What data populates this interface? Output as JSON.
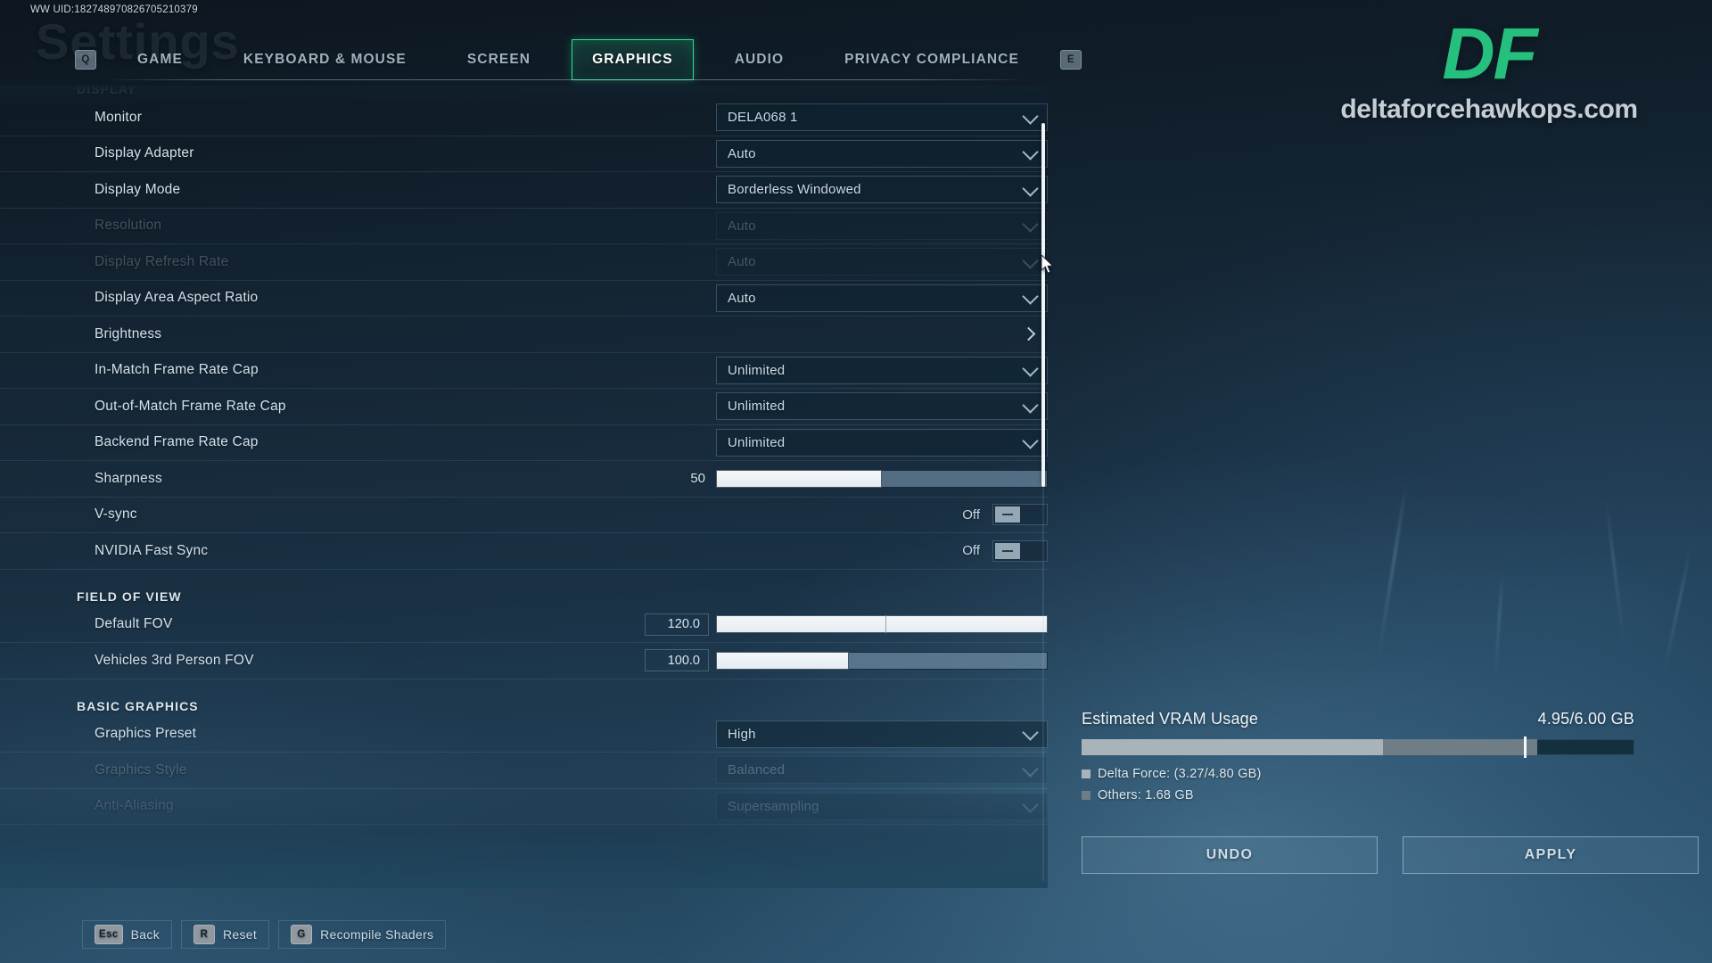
{
  "hud": {
    "uid": "WW UID:182748970826705210379",
    "ghost_title": "Settings",
    "accent_color": "#2fe08f"
  },
  "tabbar": {
    "left_key": "Q",
    "right_key": "E",
    "tabs": [
      {
        "label": "GAME",
        "active": false
      },
      {
        "label": "KEYBOARD & MOUSE",
        "active": false
      },
      {
        "label": "SCREEN",
        "active": false
      },
      {
        "label": "GRAPHICS",
        "active": true
      },
      {
        "label": "AUDIO",
        "active": false
      },
      {
        "label": "PRIVACY COMPLIANCE",
        "active": false
      }
    ]
  },
  "settings": {
    "sections": [
      {
        "title": "DISPLAY",
        "ghost": true,
        "rows": [
          {
            "type": "dropdown",
            "label": "Monitor",
            "value": "DELA068 1",
            "disabled": false
          },
          {
            "type": "dropdown",
            "label": "Display Adapter",
            "value": "Auto",
            "disabled": false
          },
          {
            "type": "dropdown",
            "label": "Display Mode",
            "value": "Borderless Windowed",
            "disabled": false
          },
          {
            "type": "dropdown",
            "label": "Resolution",
            "value": "Auto",
            "disabled": true
          },
          {
            "type": "dropdown",
            "label": "Display Refresh Rate",
            "value": "Auto",
            "disabled": true
          },
          {
            "type": "dropdown",
            "label": "Display Area Aspect Ratio",
            "value": "Auto",
            "disabled": false
          },
          {
            "type": "submenu",
            "label": "Brightness",
            "value": "",
            "disabled": false
          },
          {
            "type": "dropdown",
            "label": "In-Match Frame Rate Cap",
            "value": "Unlimited",
            "disabled": false
          },
          {
            "type": "dropdown",
            "label": "Out-of-Match Frame Rate Cap",
            "value": "Unlimited",
            "disabled": false
          },
          {
            "type": "dropdown",
            "label": "Backend Frame Rate Cap",
            "value": "Unlimited",
            "disabled": false
          },
          {
            "type": "slider",
            "label": "Sharpness",
            "value": "50",
            "percent": 50,
            "tick": null,
            "disabled": false
          },
          {
            "type": "toggle",
            "label": "V-sync",
            "value": "Off",
            "disabled": false
          },
          {
            "type": "toggle",
            "label": "NVIDIA Fast Sync",
            "value": "Off",
            "disabled": false
          }
        ]
      },
      {
        "title": "FIELD OF VIEW",
        "ghost": false,
        "rows": [
          {
            "type": "numslider",
            "label": "Default FOV",
            "value": "120.0",
            "percent": 100,
            "tick": 51,
            "disabled": false
          },
          {
            "type": "numslider",
            "label": "Vehicles 3rd Person FOV",
            "value": "100.0",
            "percent": 40,
            "tick": null,
            "disabled": false
          }
        ]
      },
      {
        "title": "BASIC GRAPHICS",
        "ghost": false,
        "rows": [
          {
            "type": "dropdown",
            "label": "Graphics Preset",
            "value": "High",
            "disabled": false
          },
          {
            "type": "dropdown",
            "label": "Graphics Style",
            "value": "Balanced",
            "disabled": true
          },
          {
            "type": "dropdown",
            "label": "Anti-Aliasing",
            "value": "Supersampling",
            "disabled": true
          }
        ]
      }
    ]
  },
  "vram": {
    "title": "Estimated VRAM Usage",
    "amount": "4.95/6.00 GB",
    "used_percent": 82.5,
    "game_percent": 54.5,
    "marker_percent": 80.0,
    "legend": [
      {
        "label": "Delta Force: (3.27/4.80 GB)",
        "color": "#a9b4ba"
      },
      {
        "label": "Others: 1.68 GB",
        "color": "#6f7d86"
      }
    ]
  },
  "buttons": {
    "undo": "UNDO",
    "apply": "APPLY"
  },
  "bottom_hints": [
    {
      "key": "Esc",
      "label": "Back"
    },
    {
      "key": "R",
      "label": "Reset"
    },
    {
      "key": "G",
      "label": "Recompile Shaders"
    }
  ],
  "watermark": {
    "logo": "DF",
    "url": "deltaforcehawkops.com",
    "logo_color": "#25c07d"
  }
}
